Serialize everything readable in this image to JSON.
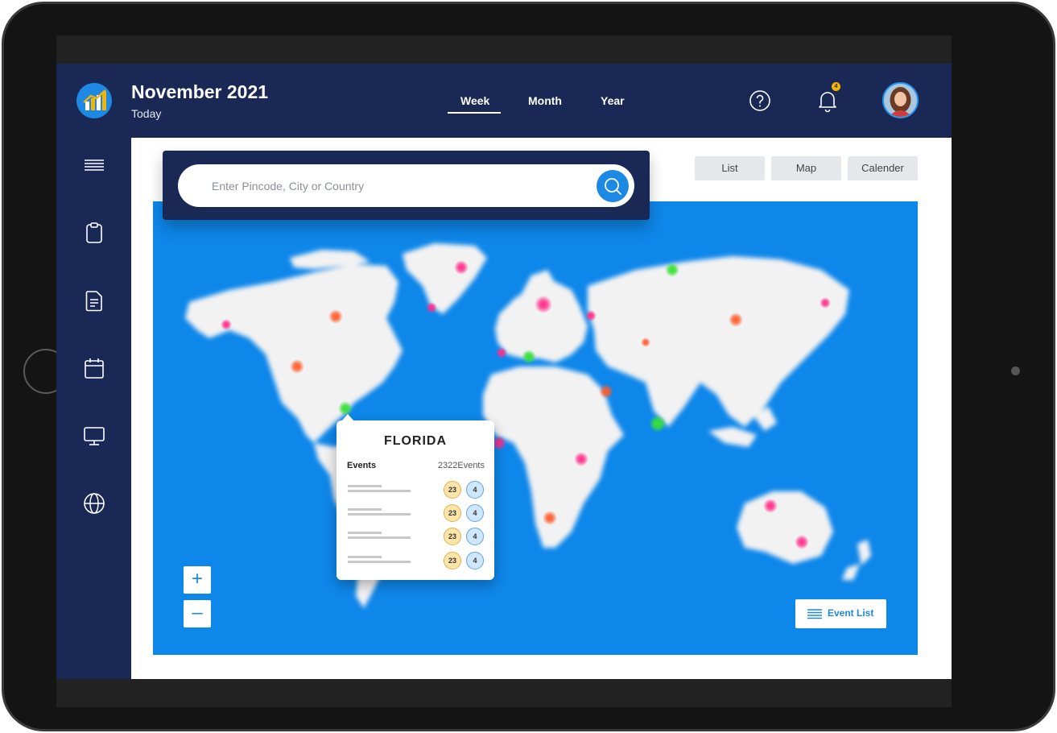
{
  "header": {
    "title": "November 2021",
    "subtitle": "Today",
    "tabs": [
      {
        "label": "Week",
        "active": true
      },
      {
        "label": "Month",
        "active": false
      },
      {
        "label": "Year",
        "active": false
      }
    ],
    "notification_count": "4",
    "icons": [
      "app-logo-icon",
      "help-icon",
      "bell-icon",
      "avatar"
    ]
  },
  "sidebar": {
    "items": [
      {
        "icon": "menu-icon"
      },
      {
        "icon": "clipboard-icon"
      },
      {
        "icon": "document-icon"
      },
      {
        "icon": "calendar-icon"
      },
      {
        "icon": "monitor-icon"
      },
      {
        "icon": "globe-icon"
      }
    ]
  },
  "search": {
    "placeholder": "Enter Pincode, City or Country",
    "value": ""
  },
  "views": {
    "list_label": "List",
    "map_label": "Map",
    "calendar_label": "Calender"
  },
  "popup": {
    "title": "FLORIDA",
    "events_label": "Events",
    "events_count": "2322Events",
    "rows": [
      {
        "a": "23",
        "b": "4"
      },
      {
        "a": "23",
        "b": "4"
      },
      {
        "a": "23",
        "b": "4"
      },
      {
        "a": "23",
        "b": "4"
      }
    ]
  },
  "map_controls": {
    "zoom_in": "+",
    "zoom_out": "–",
    "event_list_label": "Event List"
  },
  "colors": {
    "navy": "#1a2856",
    "accent": "#1e88e5",
    "map_ocean": "#0e87ea",
    "marker_pink": "#f0338a",
    "marker_orange": "#f0602f",
    "marker_green": "#3ddc3d"
  }
}
